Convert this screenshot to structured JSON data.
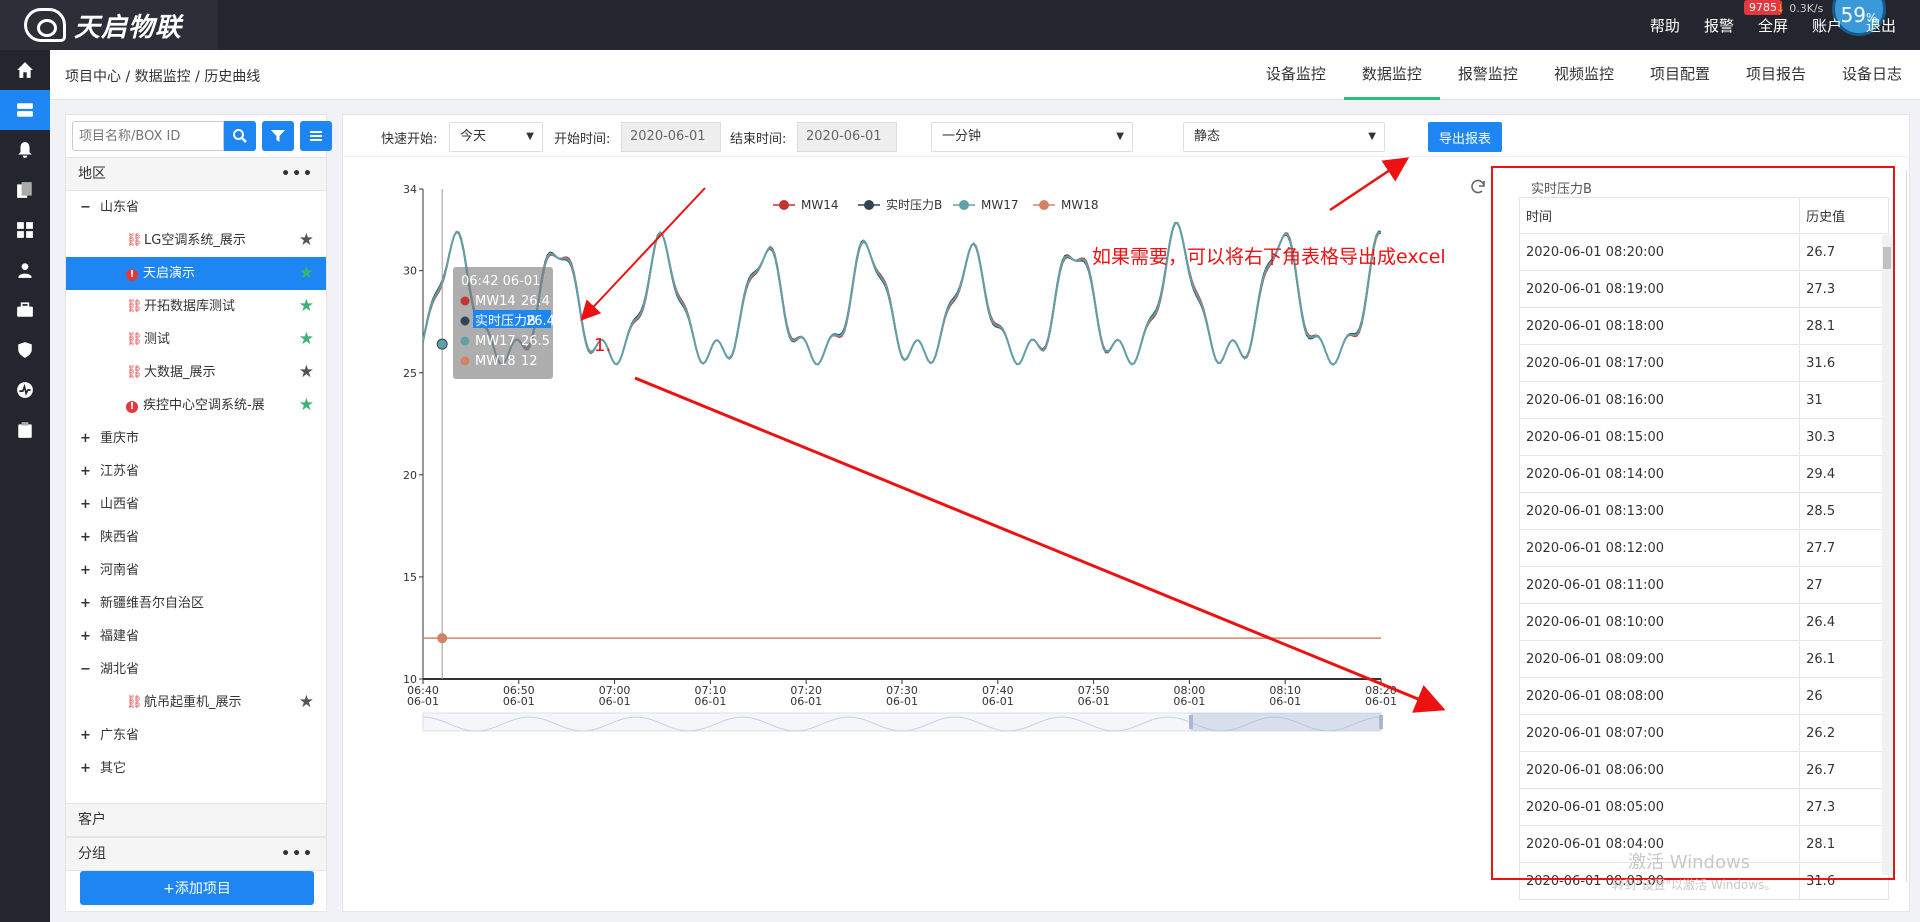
{
  "brand": {
    "logo_text": "天启物联"
  },
  "topnav": {
    "items": [
      "帮助",
      "报警",
      "全屏",
      "账户",
      "退出"
    ],
    "alarm_count": "9785",
    "net_speed": "0.3K/s",
    "gauge_value": "59",
    "gauge_unit": "%"
  },
  "breadcrumb": "项目中心 / 数据监控 / 历史曲线",
  "tabs": [
    {
      "label": "设备监控"
    },
    {
      "label": "数据监控"
    },
    {
      "label": "报警监控"
    },
    {
      "label": "视频监控"
    },
    {
      "label": "项目配置"
    },
    {
      "label": "项目报告"
    },
    {
      "label": "设备日志"
    }
  ],
  "sidebar": {
    "search_placeholder": "项目名称/BOX ID",
    "region_label": "地区",
    "tree": [
      {
        "label": "山东省",
        "toggle": "−",
        "child": false
      },
      {
        "label": "LG空调系统_展示",
        "child": true,
        "icon": "link",
        "star": "gray"
      },
      {
        "label": "天启演示",
        "child": true,
        "icon": "alert",
        "star": "green",
        "selected": true
      },
      {
        "label": "开拓数据库测试",
        "child": true,
        "icon": "link",
        "star": "green"
      },
      {
        "label": "测试",
        "child": true,
        "icon": "link",
        "star": "green"
      },
      {
        "label": "大数据_展示",
        "child": true,
        "icon": "link",
        "star": "gray"
      },
      {
        "label": "疾控中心空调系统-展",
        "child": true,
        "icon": "alert",
        "star": "green"
      },
      {
        "label": "重庆市",
        "toggle": "+",
        "child": false
      },
      {
        "label": "江苏省",
        "toggle": "+",
        "child": false
      },
      {
        "label": "山西省",
        "toggle": "+",
        "child": false
      },
      {
        "label": "陕西省",
        "toggle": "+",
        "child": false
      },
      {
        "label": "河南省",
        "toggle": "+",
        "child": false
      },
      {
        "label": "新疆维吾尔自治区",
        "toggle": "+",
        "child": false
      },
      {
        "label": "福建省",
        "toggle": "+",
        "child": false
      },
      {
        "label": "湖北省",
        "toggle": "−",
        "child": false
      },
      {
        "label": "航吊起重机_展示",
        "child": true,
        "icon": "link",
        "star": "gray"
      },
      {
        "label": "广东省",
        "toggle": "+",
        "child": false
      },
      {
        "label": "其它",
        "toggle": "+",
        "child": false
      }
    ],
    "customer_label": "客户",
    "group_label": "分组",
    "add_button": "+添加项目"
  },
  "filters": {
    "quick_label": "快速开始:",
    "quick_value": "今天",
    "start_label": "开始时间:",
    "start_value": "2020-06-01",
    "end_label": "结束时间:",
    "end_value": "2020-06-01",
    "interval_value": "一分钟",
    "mode_value": "静态",
    "export_label": "导出报表"
  },
  "chart_data": {
    "type": "line",
    "ylim": [
      10,
      34
    ],
    "yticks": [
      10,
      15,
      20,
      25,
      30,
      34
    ],
    "xticks": [
      "06:40",
      "06:50",
      "07:00",
      "07:10",
      "07:20",
      "07:30",
      "07:40",
      "07:50",
      "08:00",
      "08:10",
      "08:20"
    ],
    "xtick_date": "06-01",
    "legend": [
      "MW14",
      "实时压力B",
      "MW17",
      "MW18"
    ],
    "colors": {
      "MW14": "#c23531",
      "实时压力B": "#2f4554",
      "MW17": "#61a0a8",
      "MW18": "#d48265"
    },
    "cycle_peaks": [
      31.4,
      31.2,
      31.3,
      31.0,
      31.2,
      30.8,
      31.1,
      31.8,
      31.7
    ],
    "mw18_constant": 12,
    "tooltip": {
      "time": "06:42 06-01",
      "rows": [
        {
          "name": "MW14",
          "value": "26.4"
        },
        {
          "name": "实时压力B",
          "value": "26.4"
        },
        {
          "name": "MW17",
          "value": "26.5"
        },
        {
          "name": "MW18",
          "value": "12"
        }
      ]
    }
  },
  "table": {
    "title": "实时压力B",
    "headers": [
      "时间",
      "历史值"
    ],
    "rows": [
      [
        "2020-06-01 08:20:00",
        "26.7"
      ],
      [
        "2020-06-01 08:19:00",
        "27.3"
      ],
      [
        "2020-06-01 08:18:00",
        "28.1"
      ],
      [
        "2020-06-01 08:17:00",
        "31.6"
      ],
      [
        "2020-06-01 08:16:00",
        "31"
      ],
      [
        "2020-06-01 08:15:00",
        "30.3"
      ],
      [
        "2020-06-01 08:14:00",
        "29.4"
      ],
      [
        "2020-06-01 08:13:00",
        "28.5"
      ],
      [
        "2020-06-01 08:12:00",
        "27.7"
      ],
      [
        "2020-06-01 08:11:00",
        "27"
      ],
      [
        "2020-06-01 08:10:00",
        "26.4"
      ],
      [
        "2020-06-01 08:09:00",
        "26.1"
      ],
      [
        "2020-06-01 08:08:00",
        "26"
      ],
      [
        "2020-06-01 08:07:00",
        "26.2"
      ],
      [
        "2020-06-01 08:06:00",
        "26.7"
      ],
      [
        "2020-06-01 08:05:00",
        "27.3"
      ],
      [
        "2020-06-01 08:04:00",
        "28.1"
      ],
      [
        "2020-06-01 08:03:00",
        "31.6"
      ]
    ]
  },
  "annotation": {
    "text": "如果需要，可以将右下角表格导出成excel",
    "number": "1."
  },
  "watermark": {
    "title": "激活 Windows",
    "subtitle": "转到\"设置\"以激活 Windows。"
  }
}
